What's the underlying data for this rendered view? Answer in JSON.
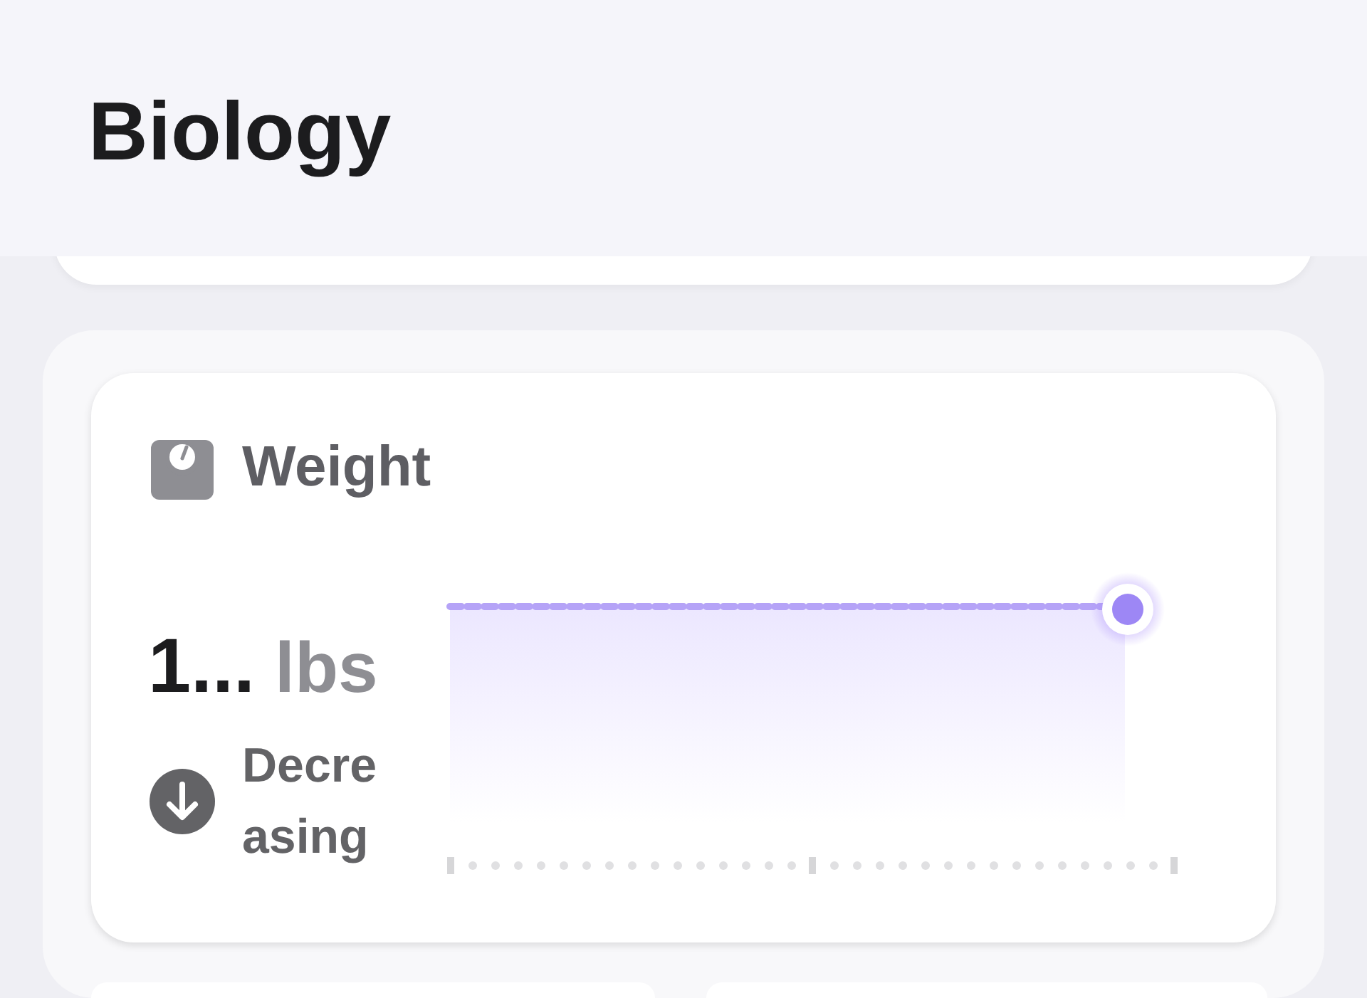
{
  "header": {
    "title": "Biology"
  },
  "weight_card": {
    "title": "Weight",
    "value": "1...",
    "unit": "lbs",
    "trend": {
      "kind": "down",
      "label": "Decreasing"
    }
  }
}
